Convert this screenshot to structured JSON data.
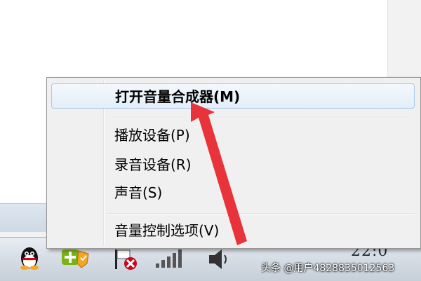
{
  "context_menu": {
    "items": [
      {
        "label": "打开音量合成器(M)"
      },
      {
        "label": "播放设备(P)"
      },
      {
        "label": "录音设备(R)"
      },
      {
        "label": "声音(S)"
      },
      {
        "label": "音量控制选项(V)"
      }
    ]
  },
  "taskbar": {
    "clock_fragment": "22:0",
    "icons": [
      "qq-icon",
      "security-shield-icon",
      "network-error-icon",
      "wifi-signal-icon",
      "speaker-icon"
    ]
  },
  "watermark": {
    "text": "头条 @用户4828835012563"
  },
  "colors": {
    "annotation_arrow": "#e8333b",
    "menu_highlight_border": "#a8c8ea",
    "menu_background": "#f0f0f0"
  }
}
